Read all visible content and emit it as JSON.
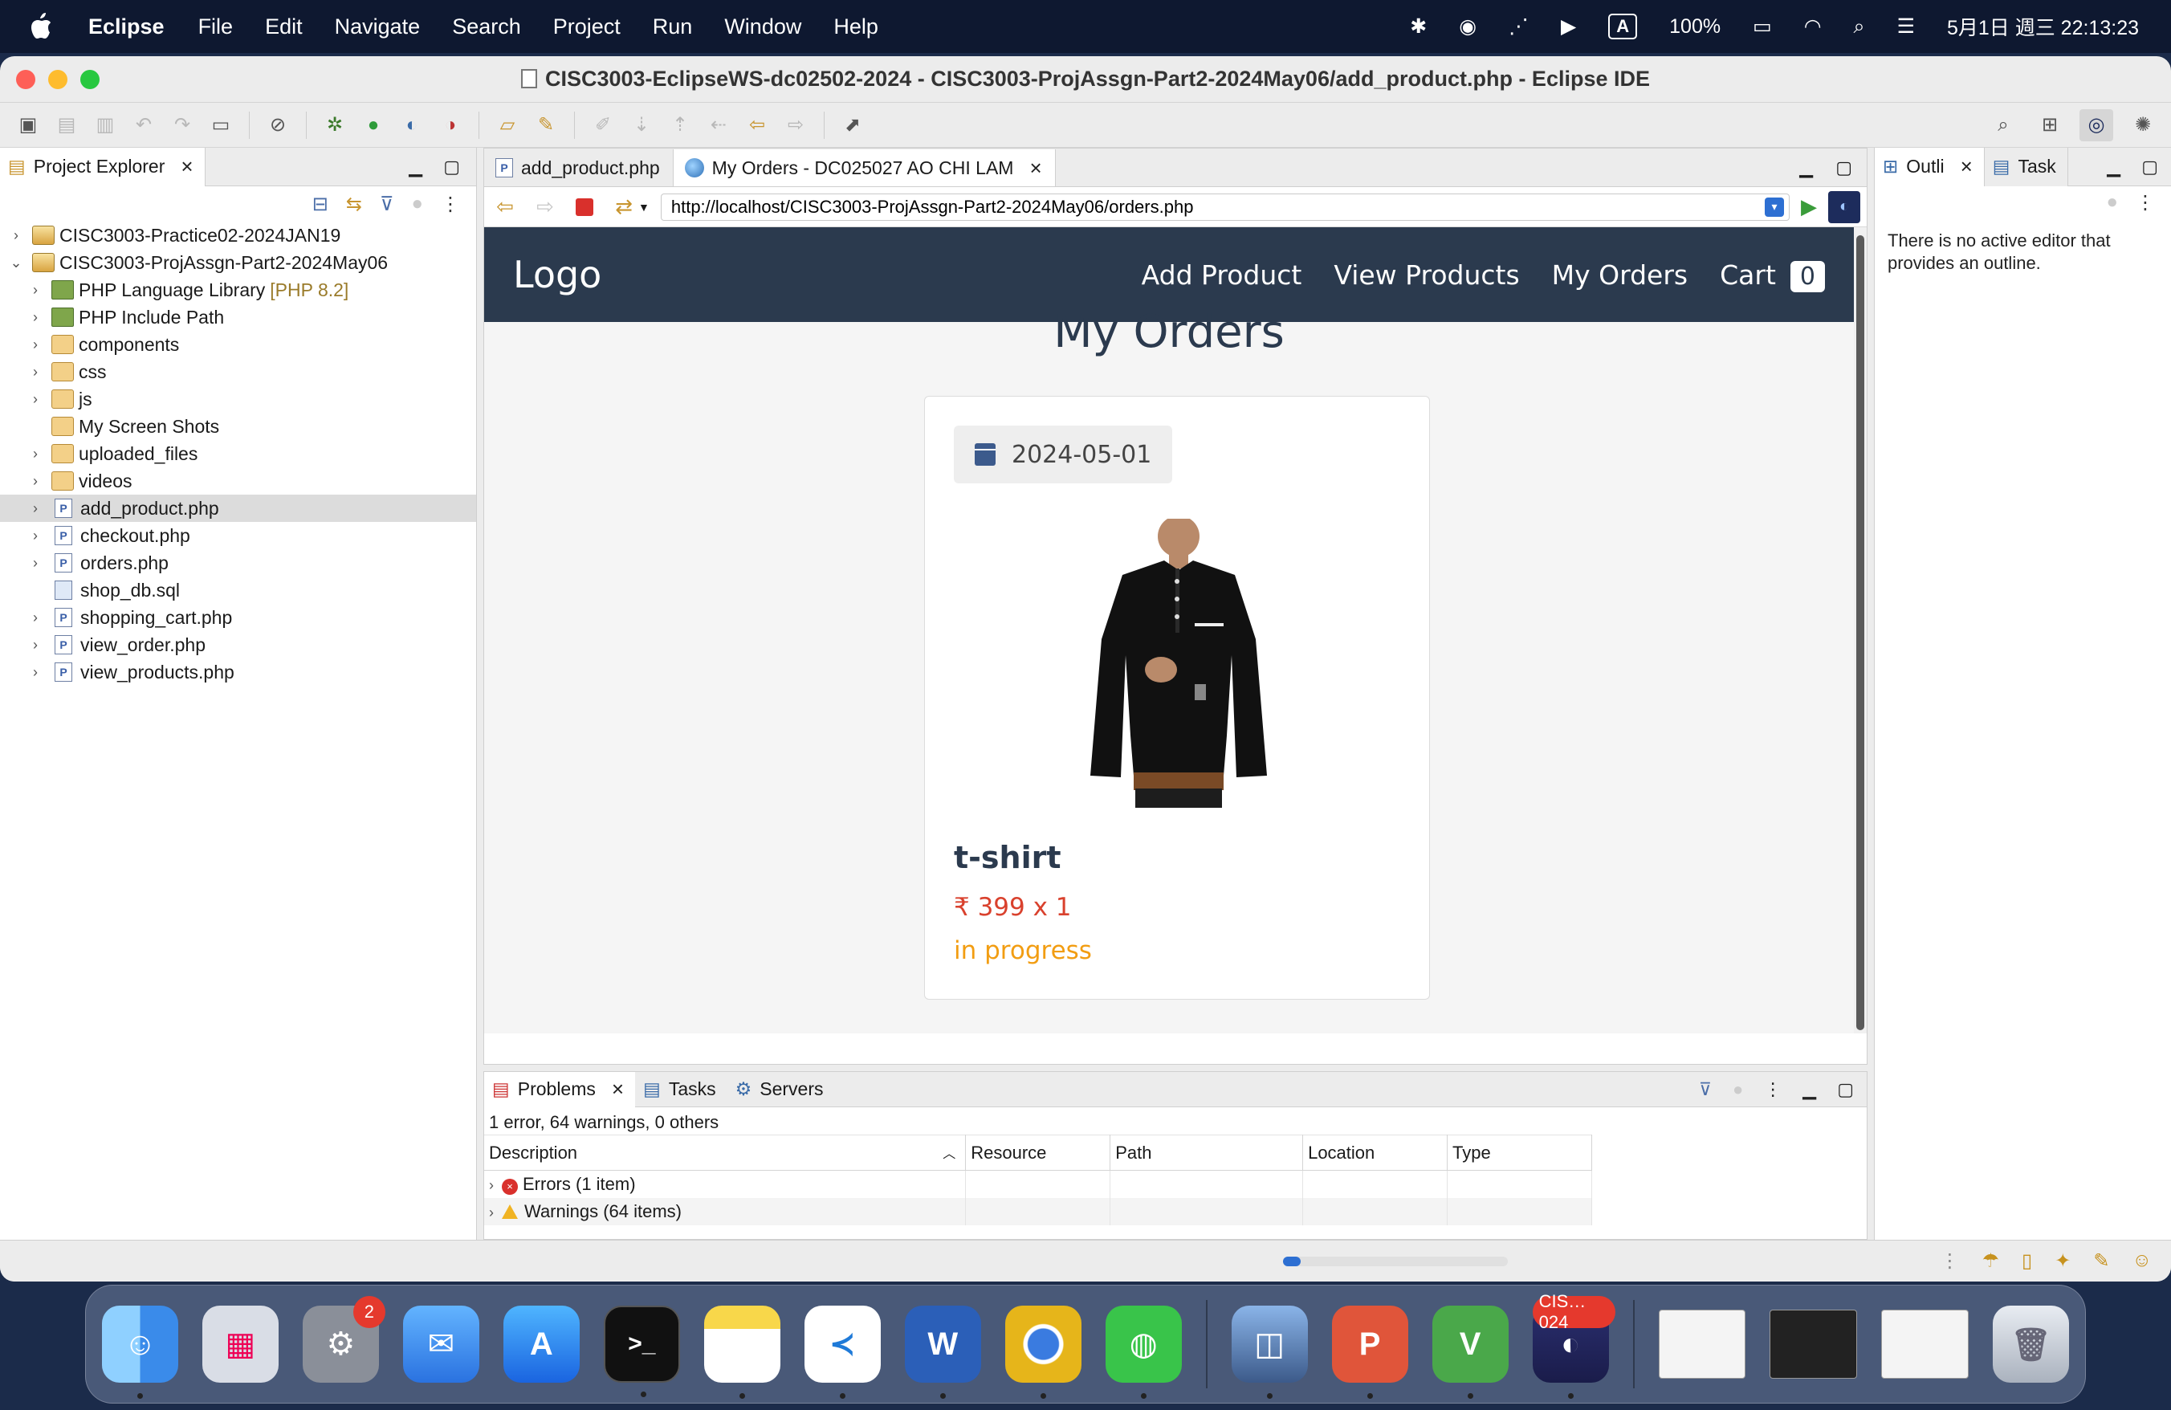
{
  "menubar": {
    "app_name": "Eclipse",
    "menus": [
      "File",
      "Edit",
      "Navigate",
      "Search",
      "Project",
      "Run",
      "Window",
      "Help"
    ],
    "input_indicator": "A",
    "battery": "100%",
    "clock": "5月1日 週三 22:13:23"
  },
  "window": {
    "title": "CISC3003-EclipseWS-dc02502-2024 - CISC3003-ProjAssgn-Part2-2024May06/add_product.php - Eclipse IDE"
  },
  "explorer": {
    "tab_label": "Project Explorer",
    "tree": [
      {
        "label": "CISC3003-Practice02-2024JAN19",
        "type": "proj",
        "expanded": false,
        "level": 0
      },
      {
        "label": "CISC3003-ProjAssgn-Part2-2024May06",
        "type": "proj",
        "expanded": true,
        "level": 0
      },
      {
        "label": "PHP Language Library",
        "suffix": "[PHP 8.2]",
        "type": "lib",
        "level": 1
      },
      {
        "label": "PHP Include Path",
        "type": "lib",
        "level": 1
      },
      {
        "label": "components",
        "type": "folder",
        "level": 1
      },
      {
        "label": "css",
        "type": "folder",
        "level": 1
      },
      {
        "label": "js",
        "type": "folder",
        "level": 1
      },
      {
        "label": "My Screen Shots",
        "type": "folder",
        "level": 1
      },
      {
        "label": "uploaded_files",
        "type": "folder",
        "level": 1
      },
      {
        "label": "videos",
        "type": "folder",
        "level": 1
      },
      {
        "label": "add_product.php",
        "type": "php",
        "level": 1,
        "selected": true
      },
      {
        "label": "checkout.php",
        "type": "php",
        "level": 1
      },
      {
        "label": "orders.php",
        "type": "php",
        "level": 1
      },
      {
        "label": "shop_db.sql",
        "type": "sql",
        "level": 1
      },
      {
        "label": "shopping_cart.php",
        "type": "php",
        "level": 1
      },
      {
        "label": "view_order.php",
        "type": "php",
        "level": 1
      },
      {
        "label": "view_products.php",
        "type": "php",
        "level": 1
      }
    ]
  },
  "editor": {
    "tabs": [
      {
        "label": "add_product.php",
        "active": false
      },
      {
        "label": "My Orders - DC025027 AO CHI LAM",
        "active": true
      }
    ],
    "url": "http://localhost/CISC3003-ProjAssgn-Part2-2024May06/orders.php"
  },
  "site": {
    "logo": "Logo",
    "nav": [
      "Add Product",
      "View Products",
      "My Orders"
    ],
    "cart_label": "Cart",
    "cart_count": "0",
    "heading": "My Orders",
    "order": {
      "date": "2024-05-01",
      "product_name": "t-shirt",
      "price": "₹ 399 x 1",
      "status": "in progress"
    }
  },
  "outline": {
    "tabs": [
      "Outli",
      "Task"
    ],
    "message": "There is no active editor that provides an outline."
  },
  "problems": {
    "tabs": [
      "Problems",
      "Tasks",
      "Servers"
    ],
    "summary": "1 error, 64 warnings, 0 others",
    "columns": [
      "Description",
      "Resource",
      "Path",
      "Location",
      "Type"
    ],
    "rows": [
      {
        "label": "Errors (1 item)",
        "kind": "error"
      },
      {
        "label": "Warnings (64 items)",
        "kind": "warning"
      }
    ]
  },
  "dock": {
    "system_settings_badge": "2",
    "eclipse_badge": "CIS…024"
  },
  "colors": {
    "site_nav": "#2b3a4e",
    "price": "#d9412d",
    "status": "#f29d12",
    "selection": "#dcdcdc"
  }
}
